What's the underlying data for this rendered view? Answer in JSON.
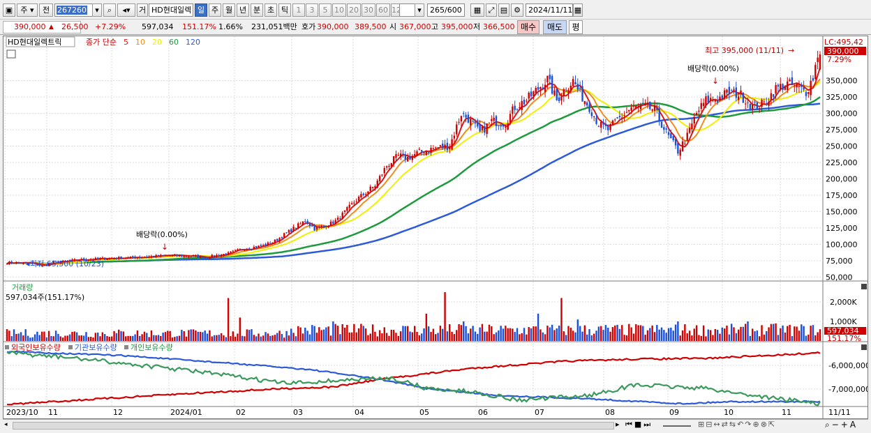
{
  "toolbar": {
    "type_select": "주",
    "prev_label": "전",
    "code_value": "267260",
    "stock_type_label": "거",
    "stock_name": "HD현대일렉",
    "periods": [
      {
        "label": "일",
        "selected": true
      },
      {
        "label": "주",
        "selected": false
      },
      {
        "label": "월",
        "selected": false
      },
      {
        "label": "년",
        "selected": false
      },
      {
        "label": "분",
        "selected": false
      },
      {
        "label": "초",
        "selected": false
      },
      {
        "label": "틱",
        "selected": false
      }
    ],
    "intervals": [
      "1",
      "3",
      "5",
      "10",
      "20",
      "30",
      "60",
      "120"
    ],
    "count_value": "265",
    "count_max": "/600",
    "date_value": "2024/11/11"
  },
  "quote": {
    "price": "390,000",
    "change": "26,500",
    "change_pct": "+7.29%",
    "volume": "597,034",
    "volume_ratio": "151.17%",
    "turnover_pct": "1.66%",
    "amount": "231,051백만",
    "ask_label": "호가",
    "ask1": "390,000",
    "ask2": "389,500",
    "open_label": "시",
    "open": "367,000",
    "high_label": "고",
    "high": "395,000",
    "low_label": "저",
    "low": "366,500",
    "buy_label": "매수",
    "sell_label": "매도",
    "eval_label": "평"
  },
  "price_panel": {
    "stock_label": "HD현대일렉트릭",
    "ma_label": "종가 단순",
    "ma_periods": [
      "5",
      "10",
      "20",
      "60",
      "120"
    ],
    "lc_label": "LC:495,42",
    "cur_price_tag": "390,000",
    "cur_pct_tag": "7.29%",
    "high_annot": "최고 395,000 (11/11)",
    "low_annot": "최저 65,500 (10/23)",
    "dividend1": "배당락(0.00%)",
    "dividend2": "배당락(0.00%)",
    "y_ticks": [
      "350,000",
      "325,000",
      "300,000",
      "275,000",
      "250,000",
      "225,000",
      "200,000",
      "175,000",
      "150,000",
      "125,000",
      "100,000",
      "75,000",
      "50,000"
    ]
  },
  "volume_panel": {
    "title": "거래량",
    "sub": "597,034주(151.17%)",
    "y_ticks": [
      "2,000K",
      "1,000K"
    ],
    "cur_tag": "597,034",
    "cur_pct": "151.17%"
  },
  "holding_panel": {
    "legend": [
      "외국인보유수량",
      "기관보유수량",
      "개인보유수량"
    ],
    "y_ticks": [
      "-6,000,000",
      "-7,000,000"
    ]
  },
  "x_axis": {
    "labels": [
      "2023/10",
      "11",
      "12",
      "2024/01",
      "02",
      "03",
      "04",
      "05",
      "06",
      "07",
      "08",
      "09",
      "10",
      "11"
    ],
    "right_label": "11/11"
  },
  "colors": {
    "up": "#d00000",
    "down": "#1c4fd8",
    "ma5": "#d81818",
    "ma10": "#f08c1c",
    "ma20": "#f0f000",
    "ma60": "#1c9a3c",
    "ma120": "#2d5ad8"
  },
  "chart_data": {
    "type": "candlestick",
    "price_anchors": [
      [
        0,
        72000
      ],
      [
        10,
        71000
      ],
      [
        15,
        67000
      ],
      [
        20,
        72000
      ],
      [
        30,
        76000
      ],
      [
        40,
        78000
      ],
      [
        55,
        80000
      ],
      [
        70,
        83000
      ],
      [
        80,
        82000
      ],
      [
        85,
        80000
      ],
      [
        95,
        86000
      ],
      [
        100,
        92000
      ],
      [
        110,
        98000
      ],
      [
        115,
        105000
      ],
      [
        122,
        122000
      ],
      [
        128,
        136000
      ],
      [
        132,
        124000
      ],
      [
        138,
        130000
      ],
      [
        142,
        138000
      ],
      [
        150,
        168000
      ],
      [
        158,
        190000
      ],
      [
        163,
        220000
      ],
      [
        168,
        235000
      ],
      [
        172,
        232000
      ],
      [
        178,
        242000
      ],
      [
        185,
        248000
      ],
      [
        190,
        250000
      ],
      [
        195,
        300000
      ],
      [
        198,
        292000
      ],
      [
        203,
        270000
      ],
      [
        208,
        288000
      ],
      [
        214,
        285000
      ],
      [
        218,
        310000
      ],
      [
        223,
        320000
      ],
      [
        228,
        338000
      ],
      [
        232,
        352000
      ],
      [
        236,
        320000
      ],
      [
        239,
        335000
      ],
      [
        243,
        350000
      ],
      [
        246,
        330000
      ],
      [
        250,
        310000
      ],
      [
        254,
        283000
      ],
      [
        258,
        275000
      ],
      [
        262,
        290000
      ],
      [
        268,
        308000
      ],
      [
        274,
        310000
      ],
      [
        278,
        305000
      ],
      [
        283,
        270000
      ],
      [
        288,
        242000
      ],
      [
        292,
        265000
      ],
      [
        296,
        300000
      ],
      [
        300,
        320000
      ],
      [
        305,
        322000
      ],
      [
        310,
        333000
      ],
      [
        315,
        328000
      ],
      [
        320,
        310000
      ],
      [
        325,
        315000
      ],
      [
        330,
        338000
      ],
      [
        335,
        345000
      ],
      [
        339,
        340000
      ],
      [
        343,
        333000
      ],
      [
        346,
        355000
      ],
      [
        348,
        390000
      ]
    ],
    "high": 395000,
    "low": 65500,
    "y_range": [
      45000,
      405000
    ]
  }
}
